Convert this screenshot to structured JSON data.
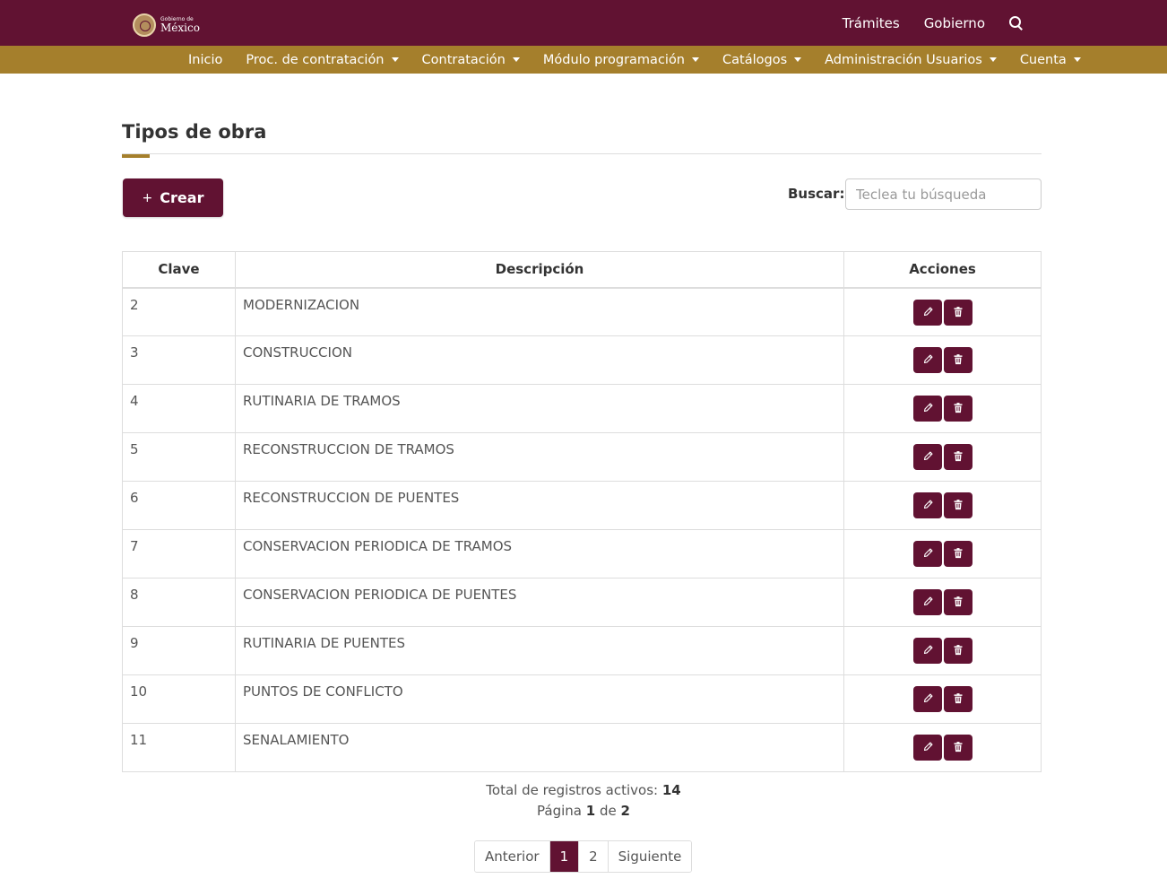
{
  "header": {
    "logo_small": "Gobierno de",
    "logo_big": "México",
    "links": [
      "Trámites",
      "Gobierno"
    ]
  },
  "nav": {
    "items": [
      {
        "label": "Inicio",
        "dropdown": false
      },
      {
        "label": "Proc. de contratación",
        "dropdown": true
      },
      {
        "label": "Contratación",
        "dropdown": true
      },
      {
        "label": "Módulo programación",
        "dropdown": true
      },
      {
        "label": "Catálogos",
        "dropdown": true
      },
      {
        "label": "Administración Usuarios",
        "dropdown": true
      },
      {
        "label": "Cuenta",
        "dropdown": true
      }
    ]
  },
  "page": {
    "title": "Tipos de obra",
    "create_label": "Crear",
    "search_label": "Buscar:",
    "search_placeholder": "Teclea tu búsqueda"
  },
  "table": {
    "headers": [
      "Clave",
      "Descripción",
      "Acciones"
    ],
    "rows": [
      {
        "clave": "2",
        "descripcion": "MODERNIZACION"
      },
      {
        "clave": "3",
        "descripcion": "CONSTRUCCION"
      },
      {
        "clave": "4",
        "descripcion": "RUTINARIA DE TRAMOS"
      },
      {
        "clave": "5",
        "descripcion": "RECONSTRUCCION DE TRAMOS"
      },
      {
        "clave": "6",
        "descripcion": "RECONSTRUCCION DE PUENTES"
      },
      {
        "clave": "7",
        "descripcion": "CONSERVACION PERIODICA DE TRAMOS"
      },
      {
        "clave": "8",
        "descripcion": "CONSERVACION PERIODICA DE PUENTES"
      },
      {
        "clave": "9",
        "descripcion": "RUTINARIA DE PUENTES"
      },
      {
        "clave": "10",
        "descripcion": "PUNTOS DE CONFLICTO"
      },
      {
        "clave": "11",
        "descripcion": "SENALAMIENTO"
      }
    ]
  },
  "footer": {
    "total_label": "Total de registros activos:",
    "total_value": "14",
    "page_label": "Página",
    "page_current": "1",
    "page_of": "de",
    "page_total": "2"
  },
  "pagination": {
    "prev": "Anterior",
    "pages": [
      "1",
      "2"
    ],
    "active": "1",
    "next": "Siguiente"
  },
  "colors": {
    "primary": "#611232",
    "accent": "#a57f2c"
  }
}
